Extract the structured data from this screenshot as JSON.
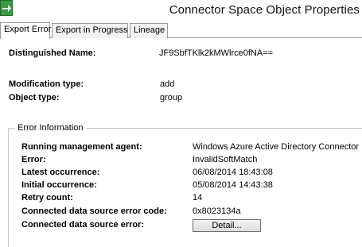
{
  "window": {
    "title": "Connector Space Object Properties",
    "icon": "green-arrow-app-icon"
  },
  "tabs": [
    {
      "label": "Export Error",
      "active": true
    },
    {
      "label": "Export in Progress",
      "active": false
    },
    {
      "label": "Lineage",
      "active": false
    }
  ],
  "object": {
    "dn_label": "Distinguished Name:",
    "dn_value": "JF9SbfTKlk2kMWlrce0fNA==",
    "modtype_label": "Modification type:",
    "modtype_value": "add",
    "objtype_label": "Object type:",
    "objtype_value": "group"
  },
  "error_info": {
    "title": "Error Information",
    "rows": [
      {
        "label": "Running management agent:",
        "value": "Windows Azure Active Directory Connector"
      },
      {
        "label": "Error:",
        "value": "InvalidSoftMatch"
      },
      {
        "label": "Latest occurrence:",
        "value": "06/08/2014 18:43:08"
      },
      {
        "label": "Initial occurrence:",
        "value": "05/08/2014 14:43:38"
      },
      {
        "label": "Retry count:",
        "value": "14"
      },
      {
        "label": "Connected data source error code:",
        "value": "0x8023134a"
      }
    ],
    "ds_error_label": "Connected data source error:",
    "detail_button": "Detail..."
  }
}
